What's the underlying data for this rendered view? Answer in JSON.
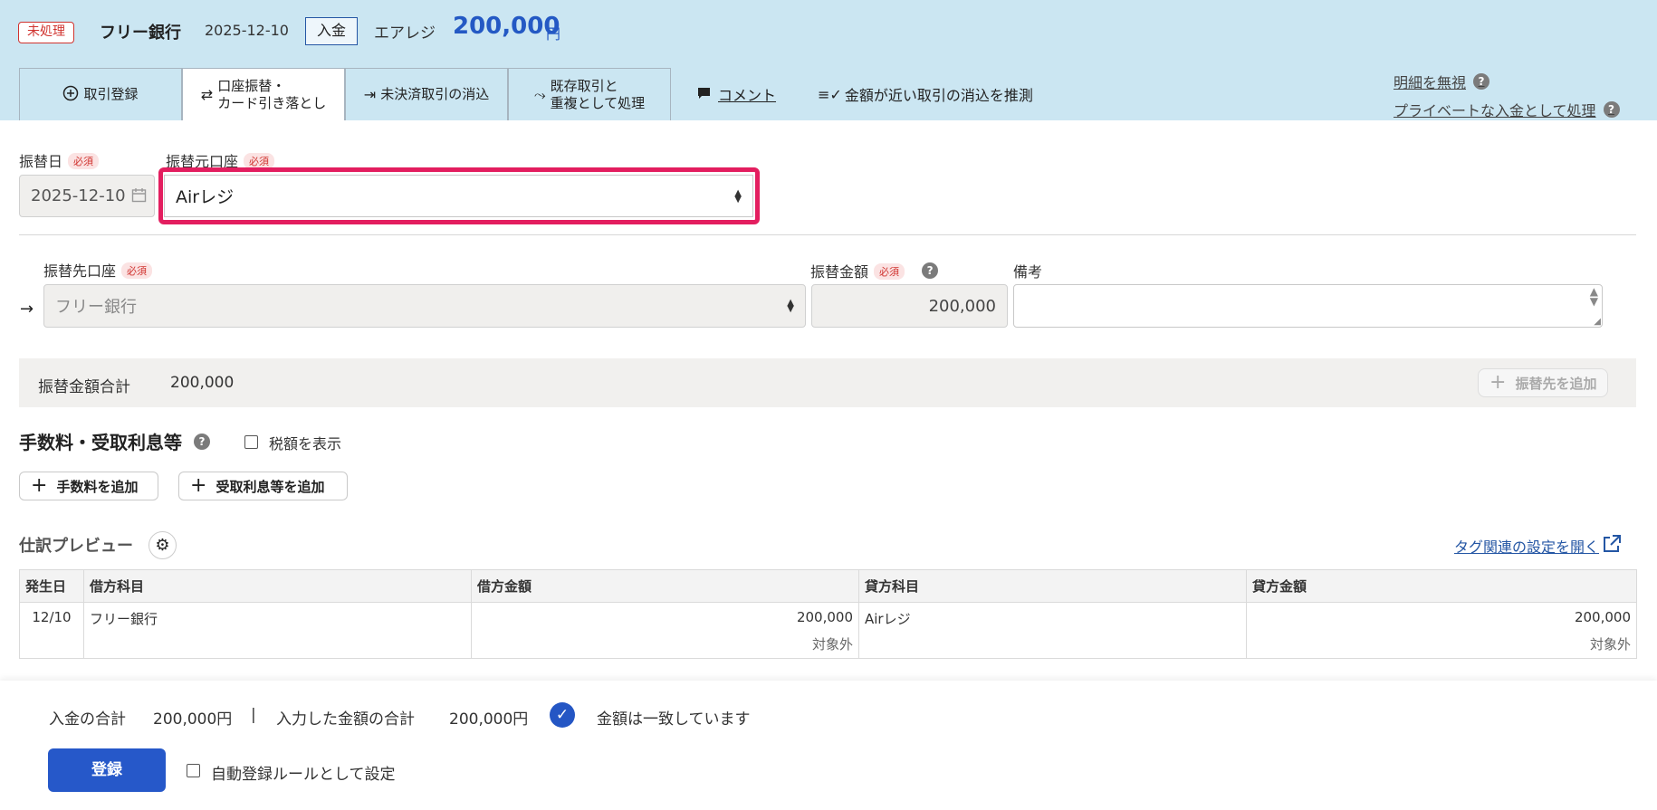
{
  "header": {
    "status_badge": "未処理",
    "bank": "フリー銀行",
    "date": "2025-12-10",
    "type": "入金",
    "partner": "エアレジ",
    "amount": "200,000",
    "unit": "円"
  },
  "tabs": [
    {
      "label": "取引登録"
    },
    {
      "label1": "口座振替・",
      "label2": "カード引き落とし"
    },
    {
      "label": "未決済取引の消込"
    },
    {
      "label1": "既存取引と",
      "label2": "重複として処理"
    }
  ],
  "actions": {
    "comment": "コメント",
    "suggest": "金額が近い取引の消込を推測",
    "ignore": "明細を無視",
    "private": "プライベートな入金として処理"
  },
  "form": {
    "required": "必須",
    "transfer_date_label": "振替日",
    "transfer_date_value": "2025-12-10",
    "source_account_label": "振替元口座",
    "source_account_value": "Airレジ",
    "dest_account_label": "振替先口座",
    "dest_account_placeholder": "フリー銀行",
    "transfer_amount_label": "振替金額",
    "transfer_amount_value": "200,000",
    "memo_label": "備考",
    "total_label": "振替金額合計",
    "total_value": "200,000",
    "add_destination": "振替先を追加"
  },
  "fees": {
    "title": "手数料・受取利息等",
    "show_tax": "税額を表示",
    "add_fee": "手数料を追加",
    "add_interest": "受取利息等を追加"
  },
  "preview": {
    "title": "仕訳プレビュー",
    "tag_link": "タグ関連の設定を開く",
    "columns": [
      "発生日",
      "借方科目",
      "借方金額",
      "貸方科目",
      "貸方金額"
    ],
    "row": {
      "date": "12/10",
      "debit_account": "フリー銀行",
      "debit_amount": "200,000",
      "debit_tax": "対象外",
      "credit_account": "Airレジ",
      "credit_amount": "200,000",
      "credit_tax": "対象外"
    }
  },
  "footer": {
    "income_total_label": "入金の合計",
    "income_total_value": "200,000円",
    "separator": "|",
    "entered_total_label": "入力した金額の合計",
    "entered_total_value": "200,000円",
    "match_message": "金額は一致しています",
    "register": "登録",
    "auto_rule": "自動登録ルールとして設定"
  },
  "colors": {
    "header_bg": "#cbe6f2",
    "accent": "#2459c4",
    "highlight": "#e31e5f",
    "required": "#d0332f"
  }
}
